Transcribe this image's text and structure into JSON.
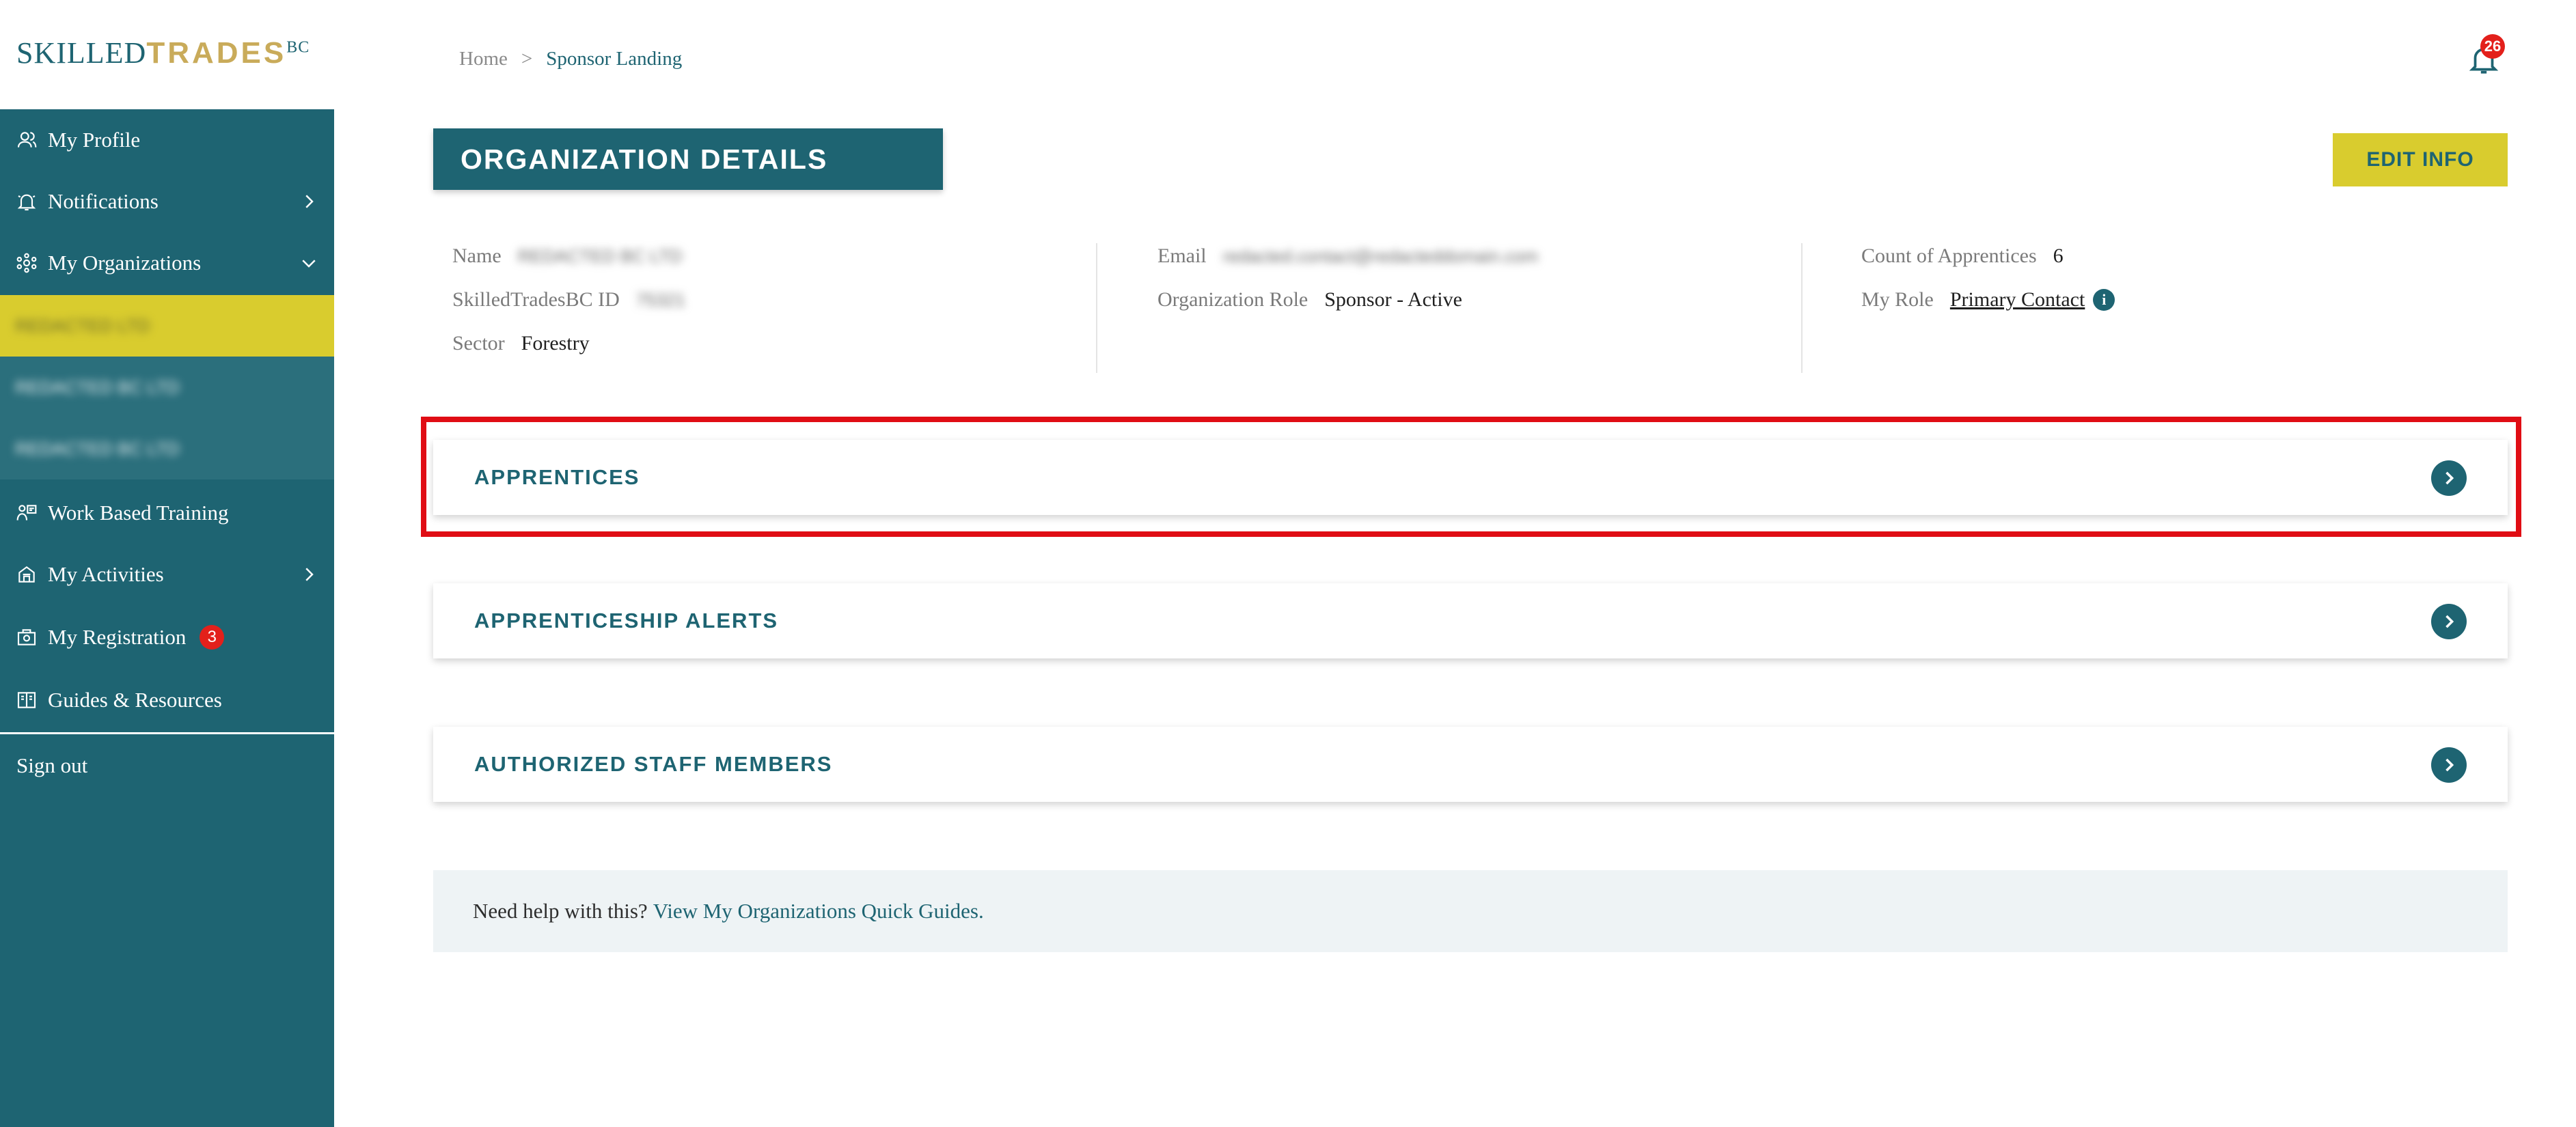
{
  "logo": {
    "part1": "SKILLED",
    "part2": "TRADES",
    "part3": "BC"
  },
  "sidebar": {
    "items": [
      {
        "label": "My Profile",
        "icon": "user-icon"
      },
      {
        "label": "Notifications",
        "icon": "bell-icon"
      },
      {
        "label": "My Organizations",
        "icon": "organizations-icon"
      },
      {
        "label": "Work Based Training",
        "icon": "training-icon"
      },
      {
        "label": "My Activities",
        "icon": "activities-icon"
      },
      {
        "label": "My Registration",
        "icon": "registration-icon",
        "badge": "3"
      },
      {
        "label": "Guides & Resources",
        "icon": "guides-icon"
      }
    ],
    "organizations": [
      "REDACTED LTD",
      "REDACTED BC LTD",
      "REDACTED BC LTD"
    ],
    "sign_out": "Sign out"
  },
  "breadcrumb": {
    "home": "Home",
    "separator": ">",
    "current": "Sponsor Landing"
  },
  "notifications_badge": "26",
  "header": {
    "title": "ORGANIZATION DETAILS",
    "edit_button": "EDIT INFO"
  },
  "details": {
    "name_label": "Name",
    "name_value": "REDACTED BC LTD",
    "id_label": "SkilledTradesBC ID",
    "id_value": "75321",
    "sector_label": "Sector",
    "sector_value": "Forestry",
    "email_label": "Email",
    "email_value": "redacted.contact@redacteddomain.com",
    "org_role_label": "Organization Role",
    "org_role_value": "Sponsor - Active",
    "count_label": "Count of Apprentices",
    "count_value": "6",
    "my_role_label": "My Role",
    "my_role_value": "Primary Contact",
    "info_icon_glyph": "i"
  },
  "sections": [
    {
      "label": "APPRENTICES"
    },
    {
      "label": "APPRENTICESHIP ALERTS"
    },
    {
      "label": "AUTHORIZED STAFF MEMBERS"
    }
  ],
  "help": {
    "question": "Need help with this?",
    "link": "View My Organizations Quick Guides."
  },
  "colors": {
    "primary": "#1e6472",
    "accent": "#d9cc2e",
    "alert": "#e3201b",
    "highlight_border": "#e00d14",
    "logo_gold": "#c9ab5a"
  }
}
